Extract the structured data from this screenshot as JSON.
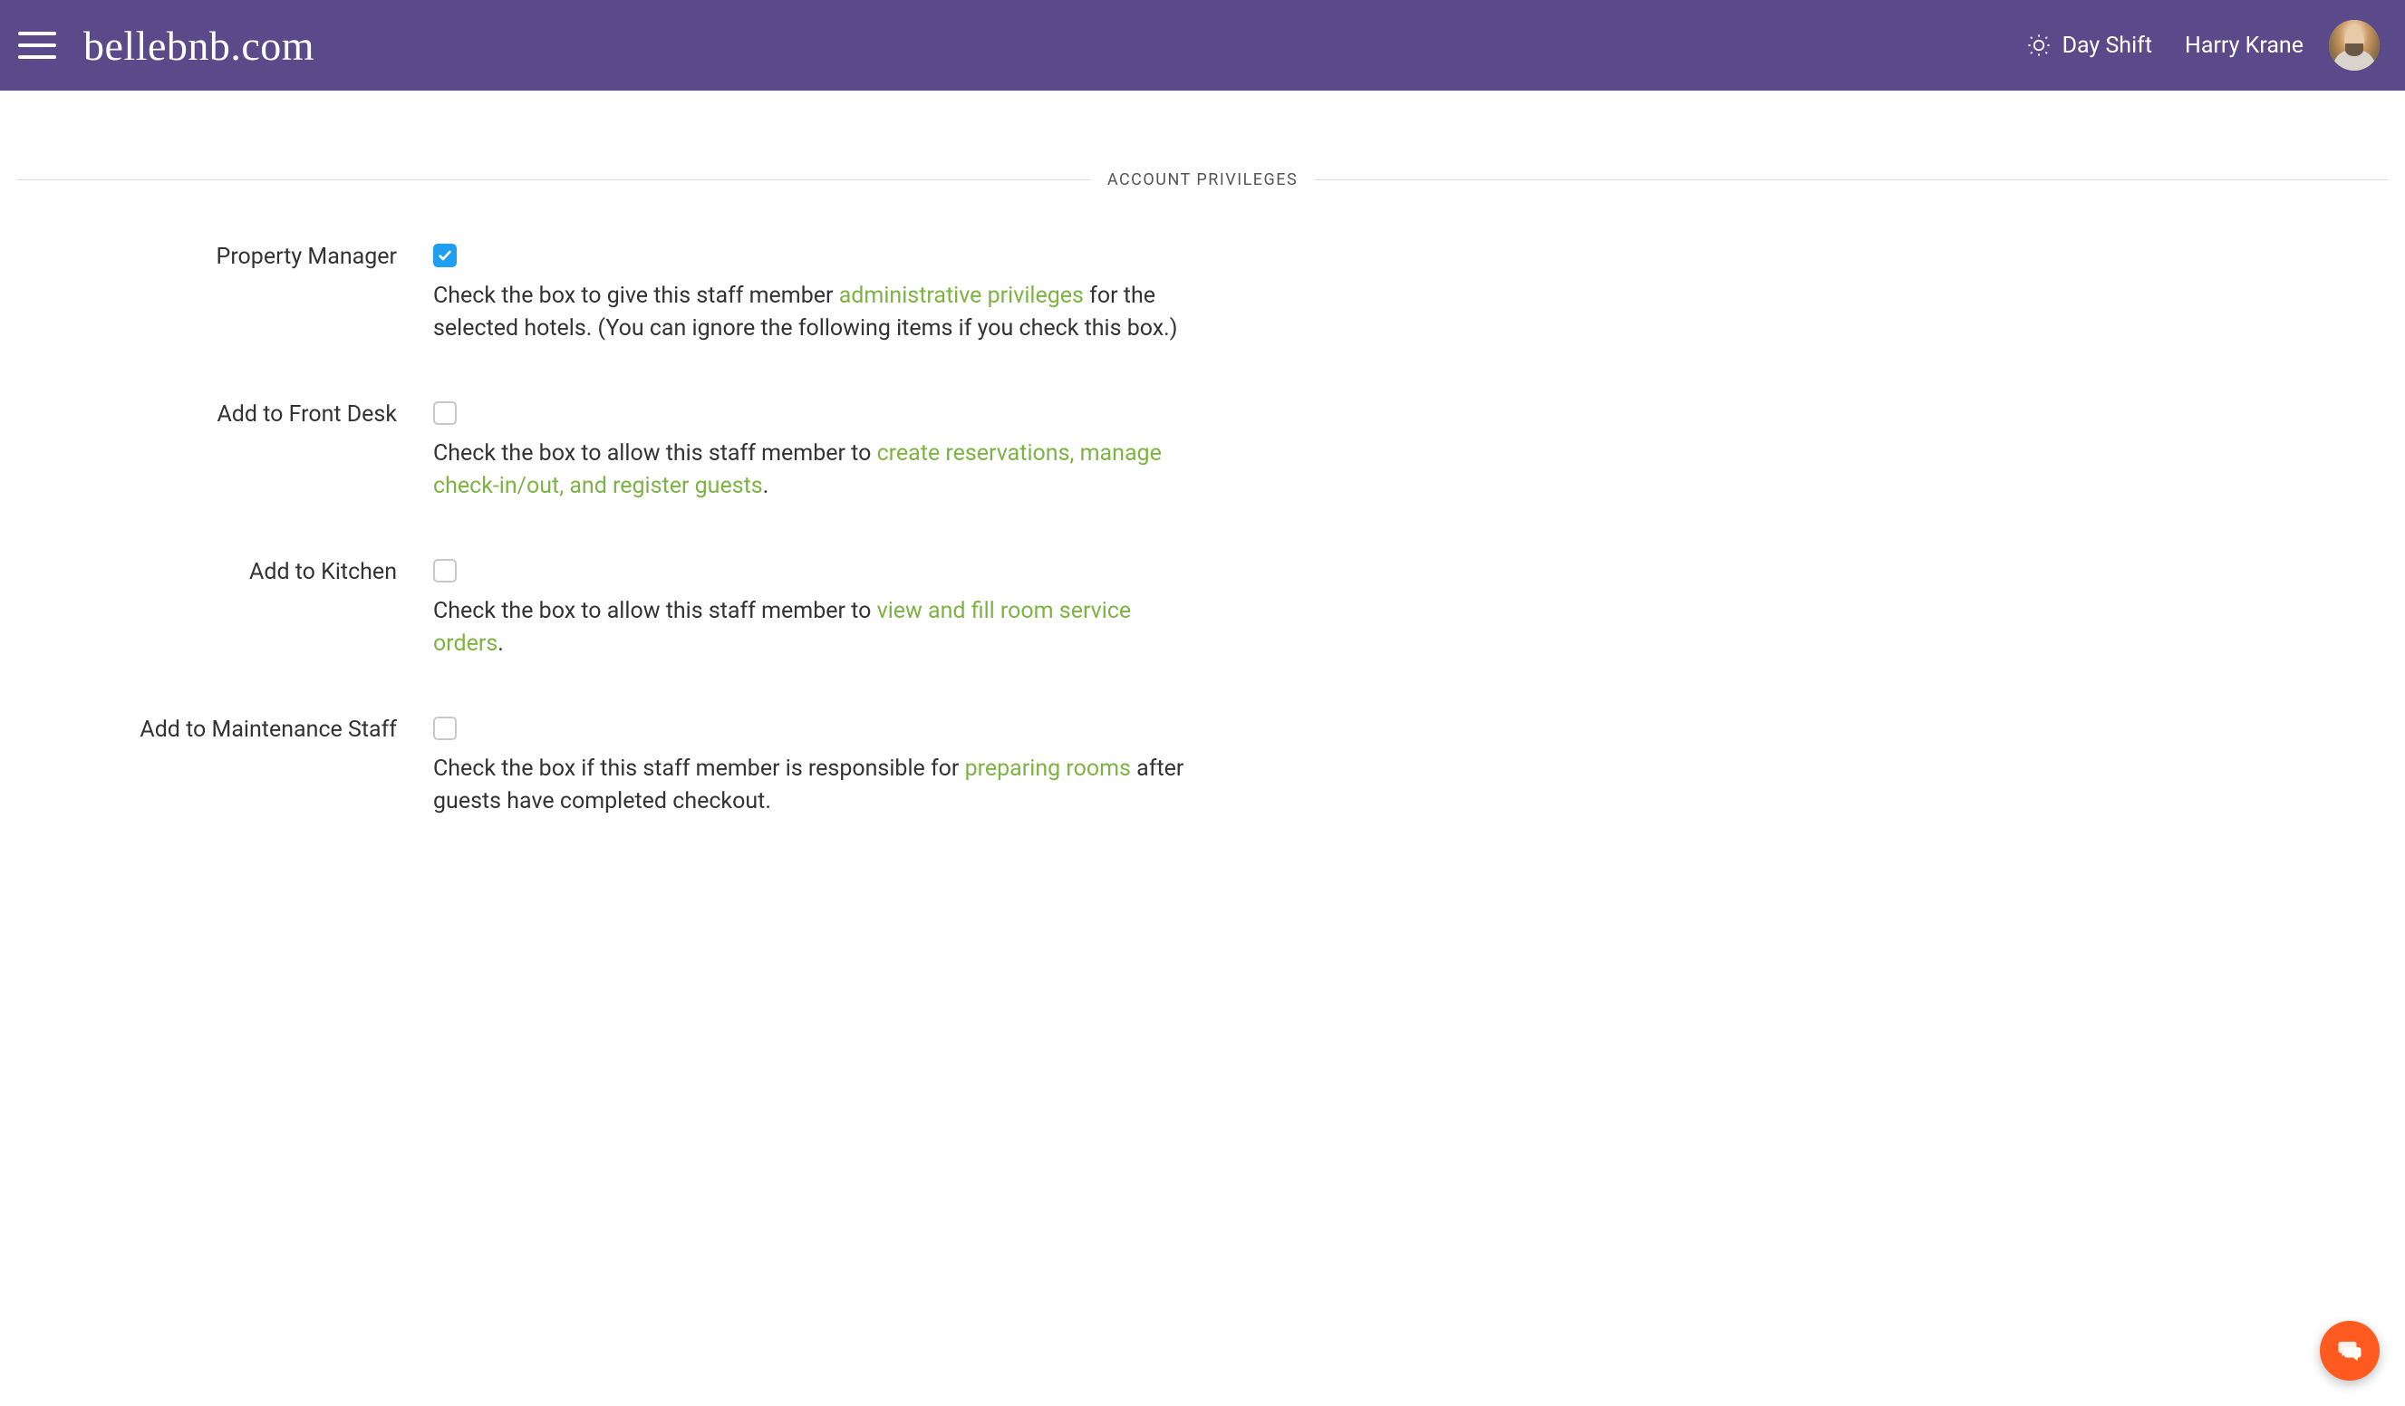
{
  "header": {
    "logo": "bellebnb.com",
    "shift_label": "Day Shift",
    "user_name": "Harry Krane"
  },
  "section": {
    "title": "ACCOUNT PRIVILEGES"
  },
  "privileges": {
    "property_manager": {
      "label": "Property Manager",
      "checked": true,
      "desc_before": "Check the box to give this staff member ",
      "desc_link": "administrative privileges",
      "desc_after": " for the selected hotels. (You can ignore the following items if you check this box.)"
    },
    "front_desk": {
      "label": "Add to Front Desk",
      "checked": false,
      "desc_before": "Check the box to allow this staff member to ",
      "desc_link": "create reservations, manage check-in/out, and register guests",
      "desc_after": "."
    },
    "kitchen": {
      "label": "Add to Kitchen",
      "checked": false,
      "desc_before": "Check the box to allow this staff member to ",
      "desc_link": "view and fill room service orders",
      "desc_after": "."
    },
    "maintenance": {
      "label": "Add to Maintenance Staff",
      "checked": false,
      "desc_before": "Check the box if this staff member is responsible for ",
      "desc_link": "preparing rooms",
      "desc_after": " after guests have completed checkout."
    }
  }
}
